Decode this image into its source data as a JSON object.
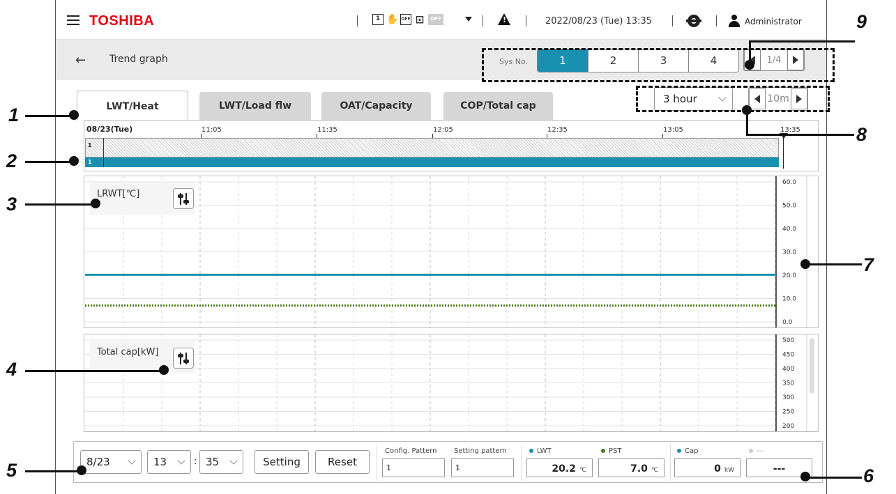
{
  "header": {
    "brand": "TOSHIBA",
    "mode_icons": [
      "1",
      "✋",
      "OFF",
      "⊡",
      "OFF"
    ],
    "datetime": "2022/08/23 (Tue) 13:35",
    "user": "Administrator"
  },
  "subheader": {
    "title": "Trend graph",
    "sys_label": "Sys No.",
    "sys_buttons": [
      "1",
      "2",
      "3",
      "4"
    ],
    "sys_active": "1",
    "page": "1/4"
  },
  "tabs": [
    "LWT/Heat",
    "LWT/Load flw",
    "OAT/Capacity",
    "COP/Total cap"
  ],
  "range": {
    "value": "3 hour",
    "step": "10m"
  },
  "timeline": {
    "date": "08/23(Tue)",
    "ticks": [
      "11:05",
      "11:35",
      "12:05",
      "12:35",
      "13:05",
      "13:35"
    ],
    "row1": "1",
    "row2": "1"
  },
  "panels": {
    "top": {
      "label": "LRWT[℃]",
      "yticks": [
        "60.0",
        "50.0",
        "40.0",
        "30.0",
        "20.0",
        "10.0",
        "0.0"
      ]
    },
    "bottom": {
      "label": "Total cap[kW]",
      "yticks": [
        "500",
        "450",
        "400",
        "350",
        "300",
        "250",
        "200"
      ]
    }
  },
  "chart_data": [
    {
      "type": "line",
      "title": "",
      "ylabel": "LRWT[℃]",
      "ylim": [
        0,
        60
      ],
      "series": [
        {
          "name": "LWT",
          "color": "#1a90b0",
          "values": [
            20.2,
            20.2
          ]
        },
        {
          "name": "PST",
          "color": "#4a7a1a",
          "values": [
            7.0,
            7.0
          ]
        }
      ]
    },
    {
      "type": "line",
      "title": "",
      "ylabel": "Total cap[kW]",
      "ylim": [
        200,
        500
      ],
      "series": []
    }
  ],
  "bottom": {
    "date": "8/23",
    "hour": "13",
    "minute": "35",
    "setting_label": "Setting",
    "reset_label": "Reset",
    "config_pattern_label": "Config. Pattern",
    "config_pattern_value": "1",
    "setting_pattern_label": "Setting pattern",
    "setting_pattern_value": "1",
    "lwt_label": "LWT",
    "lwt_value": "20.2",
    "lwt_unit": "℃",
    "pst_label": "PST",
    "pst_value": "7.0",
    "pst_unit": "℃",
    "cap_label": "Cap",
    "cap_value": "0",
    "cap_unit": "kW",
    "extra_label": "---",
    "extra_value": "---"
  },
  "colors": {
    "accent": "#1a90b0",
    "brand": "#e60012",
    "pst": "#4a7a1a"
  },
  "callouts": [
    "1",
    "2",
    "3",
    "4",
    "5",
    "6",
    "7",
    "8",
    "9"
  ]
}
